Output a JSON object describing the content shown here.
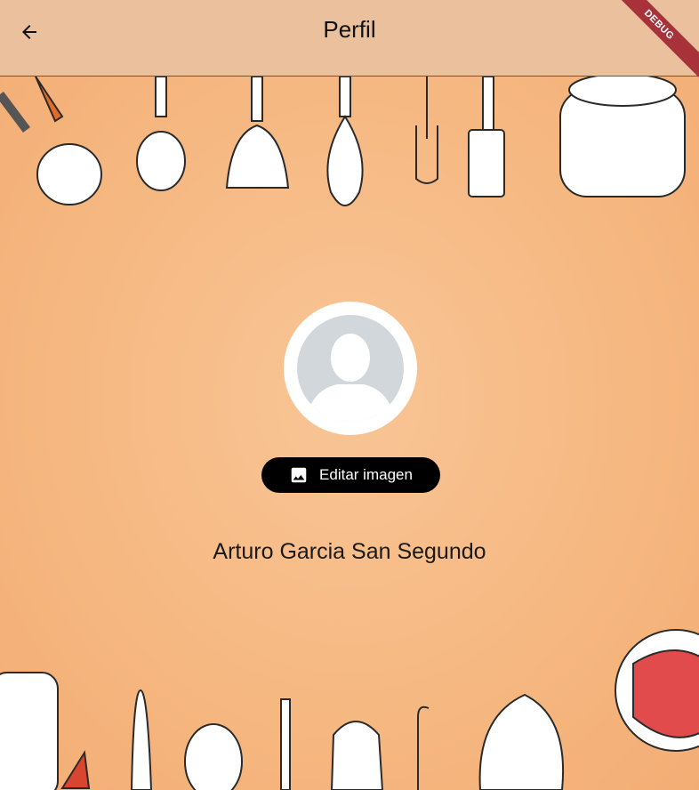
{
  "appbar": {
    "title": "Perfil",
    "back_icon": "arrow-left-icon",
    "debug_banner": "DEBUG"
  },
  "profile": {
    "avatar_icon": "person-placeholder-icon",
    "edit_button_label": "Editar imagen",
    "edit_button_icon": "image-icon",
    "name": "Arturo Garcia San Segundo"
  },
  "colors": {
    "appbar_bg": "#ebc09d",
    "background": "#f6b780",
    "button_bg": "#000000",
    "debug_banner": "#a8323a"
  }
}
